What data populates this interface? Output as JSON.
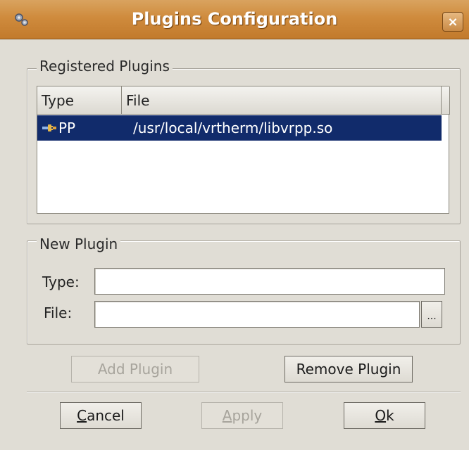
{
  "window": {
    "title": "Plugins Configuration",
    "close_label": "×"
  },
  "registered": {
    "title": "Registered Plugins",
    "columns": [
      "Type",
      "File"
    ],
    "rows": [
      {
        "type": "PP",
        "file": "/usr/local/vrtherm/libvrpp.so",
        "selected": true
      }
    ]
  },
  "new_plugin": {
    "title": "New Plugin",
    "type_label": "Type:",
    "type_value": "",
    "file_label": "File:",
    "file_value": "",
    "browse_label": "..."
  },
  "actions": {
    "add_label": "Add Plugin",
    "remove_label": "Remove Plugin"
  },
  "footer": {
    "cancel_mnemonic": "C",
    "cancel_rest": "ancel",
    "apply_mnemonic": "A",
    "apply_rest": "pply",
    "ok_mnemonic": "O",
    "ok_rest": "k"
  },
  "colors": {
    "titlebar": "#cf8b3d",
    "selection": "#112b6b",
    "window": "#e0ddd5"
  },
  "icons": {
    "app": "gear-icon",
    "row": "plugin-icon"
  }
}
